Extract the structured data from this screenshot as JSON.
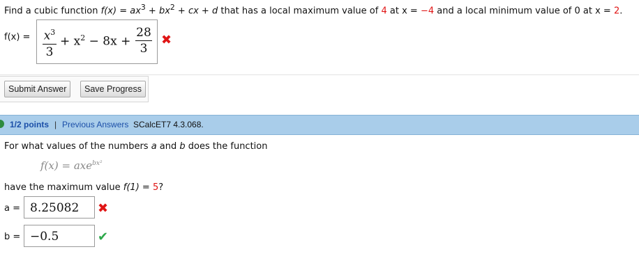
{
  "question1": {
    "prefix": "Find a cubic function ",
    "func_name": "f(x)",
    "eq_sign": " = ",
    "poly_part1": "ax",
    "poly_exp3": "3",
    "poly_part2": " + bx",
    "poly_exp2": "2",
    "poly_part3": " + cx + d",
    "mid1": " that has a local maximum value of ",
    "max_value": "4",
    "mid2": " at x = ",
    "max_x": "−4",
    "mid3": " and a local minimum value of 0 at x = ",
    "min_x": "2",
    "end": "."
  },
  "answer1": {
    "label": "f(x) =",
    "frac1_num": "x",
    "frac1_num_exp": "3",
    "frac1_den": "3",
    "middle": "+ x",
    "middle_exp": "2",
    "middle2": "− 8x +",
    "frac2_num": "28",
    "frac2_den": "3",
    "status_mark": "✖"
  },
  "buttons": {
    "submit": "Submit Answer",
    "save": "Save Progress"
  },
  "header": {
    "points": "1/2 points",
    "separator": "|",
    "previous": "Previous Answers",
    "code": "SCalcET7 4.3.068."
  },
  "question2": {
    "intro_1": "For what values of the numbers ",
    "var_a": "a",
    "intro_2": " and ",
    "var_b": "b",
    "intro_3": " does the function",
    "formula": "f(x) = axe",
    "formula_exp": "bx²",
    "tail_1": "have the maximum value ",
    "tail_func": "f(1)",
    "tail_eq": " = ",
    "tail_val": "5",
    "tail_end": "?"
  },
  "inputs": {
    "a_label": "a =",
    "a_value": "8.25082",
    "a_mark": "✖",
    "b_label": "b =",
    "b_value": "−0.5",
    "b_mark": "✔"
  },
  "colors": {
    "header_bg": "#a9cdea",
    "incorrect": "#e01515",
    "correct": "#2da84a",
    "link": "#1b4fa8"
  }
}
